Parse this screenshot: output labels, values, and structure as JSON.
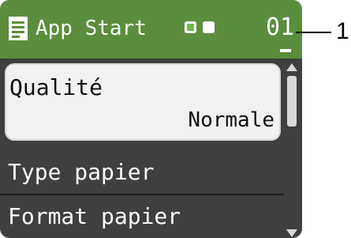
{
  "header": {
    "icon": "document-icon",
    "title": "App Start",
    "status_indicators": [
      "green-square",
      "white-square"
    ],
    "counter": "01"
  },
  "callout": {
    "number": "1"
  },
  "menu": {
    "selected": {
      "label": "Qualité",
      "value": "Normale"
    },
    "items": [
      {
        "label": "Type papier"
      },
      {
        "label": "Format papier"
      }
    ]
  },
  "colors": {
    "titlebar": "#5a8e3c",
    "screen": "#3f3f3f",
    "selected_bg": "#f1f1f1"
  }
}
